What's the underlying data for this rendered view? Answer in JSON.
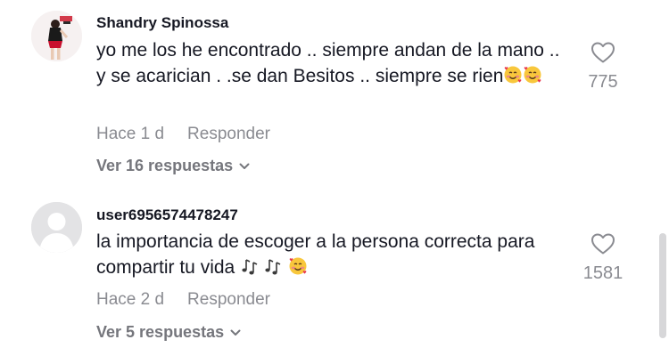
{
  "comments": [
    {
      "username": "Shandry Spinossa",
      "text": "yo me los he encontrado .. siempre andan de la mano .. y se acarician . .se dan Besitos .. siempre se rien",
      "emoji": [
        "smiling-face-with-hearts",
        "smiling-face-with-hearts"
      ],
      "time": "Hace 1 d",
      "reply_label": "Responder",
      "view_replies": "Ver 16 respuestas",
      "likes": "775",
      "avatar": "profile-photo"
    },
    {
      "username": "user6956574478247",
      "text": "la importancia de escoger a la persona correcta para compartir tu vida",
      "emoji": [
        "multiple-musical-notes",
        "multiple-musical-notes",
        "smiling-face-with-hearts"
      ],
      "time": "Hace 2 d",
      "reply_label": "Responder",
      "view_replies": "Ver 5 respuestas",
      "likes": "1581",
      "avatar": "default-avatar"
    }
  ],
  "colors": {
    "text": "#161823",
    "muted": "#8a8b91",
    "replies": "#75767c",
    "avatar_default": "#e3e3e5",
    "scrollbar": "#d7d7d9"
  }
}
